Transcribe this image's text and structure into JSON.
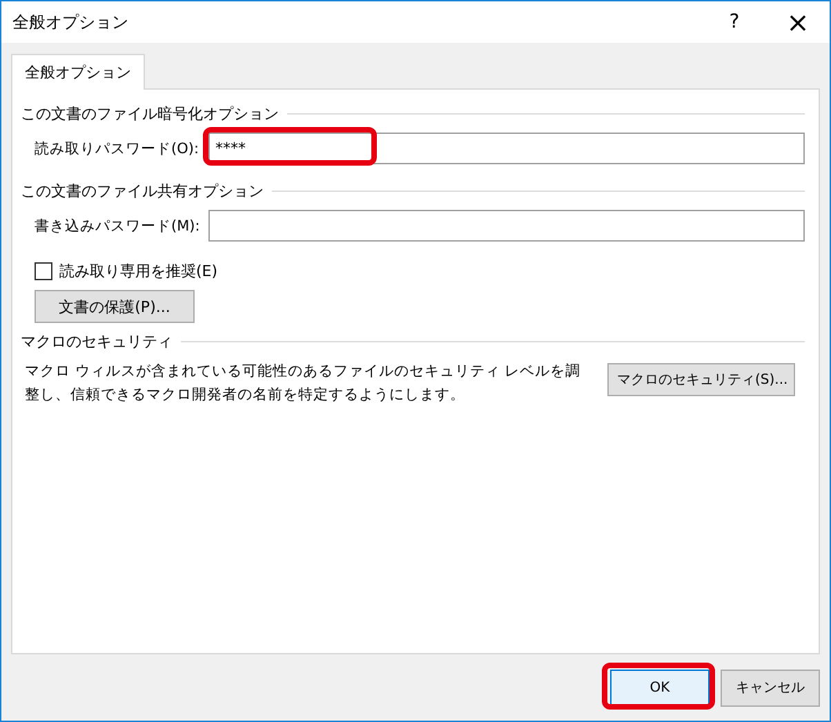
{
  "window": {
    "title": "全般オプション",
    "help": "?",
    "close": "×"
  },
  "tabs": [
    {
      "label": "全般オプション",
      "selected": true
    }
  ],
  "encryption": {
    "heading": "この文書のファイル暗号化オプション",
    "field": {
      "label": "読み取りパスワード(O):",
      "value": "****",
      "highlighted": true
    }
  },
  "sharing": {
    "heading": "この文書のファイル共有オプション",
    "field": {
      "label": "書き込みパスワード(M):"
    },
    "checkbox": {
      "label": "読み取り専用を推奨(E)",
      "checked": false
    },
    "button": "文書の保護(P)..."
  },
  "macro": {
    "heading": "マクロのセキュリティ",
    "description": "マクロ ウィルスが含まれている可能性のあるファイルのセキュリティ レベルを調整し、信頼できるマクロ開発者の名前を特定するようにします。",
    "button": "マクロのセキュリティ(S)..."
  },
  "buttons": [
    {
      "label": "OK",
      "kind": "default",
      "highlighted": true
    },
    {
      "label": "キャンセル",
      "kind": "normal",
      "highlighted": false
    }
  ]
}
